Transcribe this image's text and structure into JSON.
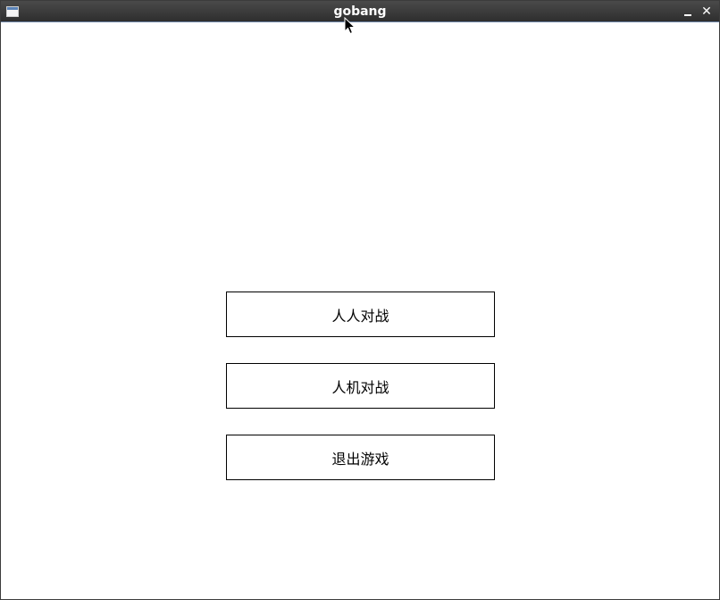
{
  "window": {
    "title": "gobang",
    "minimize_icon": "minimize-icon",
    "close_glyph": "✕"
  },
  "menu": {
    "pvp_label": "人人对战",
    "pve_label": "人机对战",
    "exit_label": "退出游戏"
  }
}
